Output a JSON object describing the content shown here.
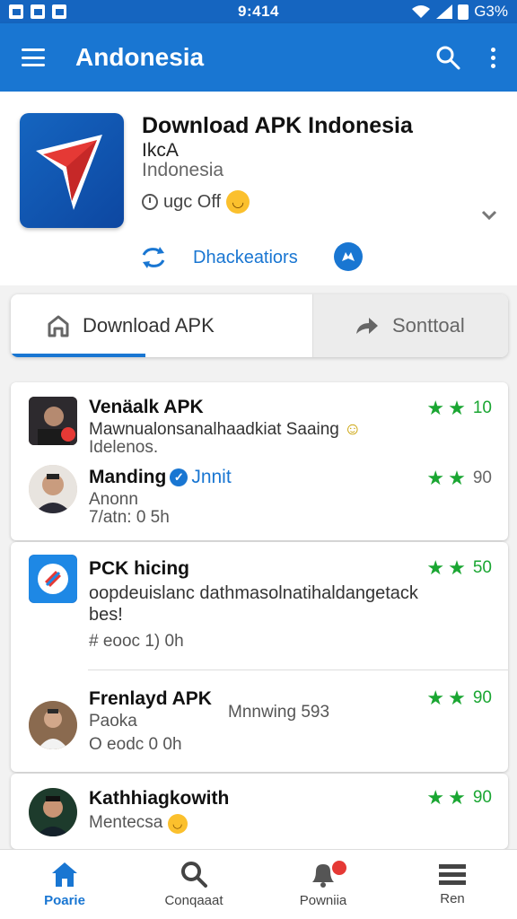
{
  "status_bar": {
    "time": "9:414",
    "battery": "G3%"
  },
  "app_bar": {
    "title": "Andonesia"
  },
  "header": {
    "title": "Download APK Indonesia",
    "subtitle": "IkcA",
    "region": "Indonesia",
    "meta": "ugc Off",
    "link_label": "Dhackeatiors"
  },
  "tabs": [
    {
      "label": "Download APK",
      "active": true
    },
    {
      "label": "Sonttoal",
      "active": false
    }
  ],
  "items": [
    {
      "title": "Venäalk APK",
      "line1": "Mawnualonsanalhaadkiat Saaing",
      "line2": "Idelenos.",
      "stars": 2,
      "rating": "10",
      "rating_color": "green"
    },
    {
      "title": "Manding",
      "link": "Jnnit",
      "line1": "Anonn",
      "line2": "7/atn: 0 5h",
      "stars": 2,
      "rating": "90",
      "rating_color": "gray"
    },
    {
      "title": "PCK hicing",
      "line1": "oopdeuislanc dathmasolnatihaldangetack",
      "line2": "bes!",
      "line3": "# eooc 1) 0h",
      "stars": 2,
      "rating": "50",
      "rating_color": "green"
    },
    {
      "title": "Frenlayd APK",
      "line1": "Paoka",
      "line2": "O eodc 0 0h",
      "side_text": "Mnnwing 593",
      "stars": 2,
      "rating": "90",
      "rating_color": "green"
    },
    {
      "title": "Kathhiagkowith",
      "line1": "Mentecsa",
      "stars": 2,
      "rating": "90",
      "rating_color": "green"
    }
  ],
  "bottom_nav": [
    {
      "label": "Poarie",
      "icon": "home-icon",
      "active": true
    },
    {
      "label": "Conqaaat",
      "icon": "search-icon",
      "active": false
    },
    {
      "label": "Powniia",
      "icon": "bell-icon",
      "active": false
    },
    {
      "label": "Ren",
      "icon": "list-icon",
      "active": false
    }
  ],
  "colors": {
    "primary": "#1976d2",
    "star": "#1aa632",
    "badge": "#e53935"
  }
}
